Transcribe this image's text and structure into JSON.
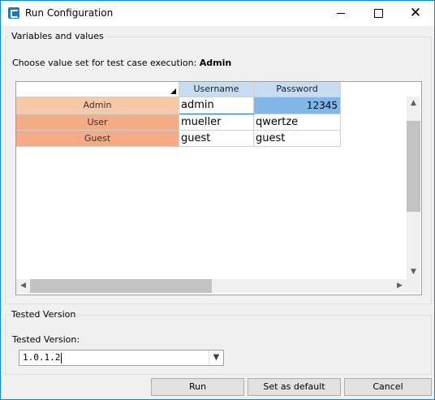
{
  "window": {
    "title": "Run Configuration",
    "icons": {
      "app": "app-logo-icon",
      "minimize": "minimize-icon",
      "maximize": "maximize-icon",
      "close": "close-icon",
      "close_glyph": "✕"
    }
  },
  "variables": {
    "group_title": "Variables and values",
    "choose_prefix": "Choose value set for test case execution:",
    "selected_set": "Admin",
    "grid": {
      "columns": [
        "Username",
        "Password"
      ],
      "rows": [
        {
          "name": "Admin",
          "username": "admin",
          "password": "12345"
        },
        {
          "name": "User",
          "username": "mueller",
          "password": "qwertze"
        },
        {
          "name": "Guest",
          "username": "guest",
          "password": "guest"
        }
      ],
      "scroll_glyphs": {
        "up": "▲",
        "down": "▼",
        "left": "◀",
        "right": "▶"
      }
    }
  },
  "tested_version": {
    "group_title": "Tested Version",
    "label": "Tested Version:",
    "value": "1.0.1.2",
    "dropdown_glyph": "▼"
  },
  "buttons": {
    "run": "Run",
    "set_default": "Set as default",
    "cancel": "Cancel"
  },
  "colors": {
    "selected_row_header": "#f8c9a6",
    "row_header": "#f4ab86",
    "column_header": "#c6dcf2",
    "selected_cell": "#80b7e8",
    "window_border": "#1883d7"
  }
}
